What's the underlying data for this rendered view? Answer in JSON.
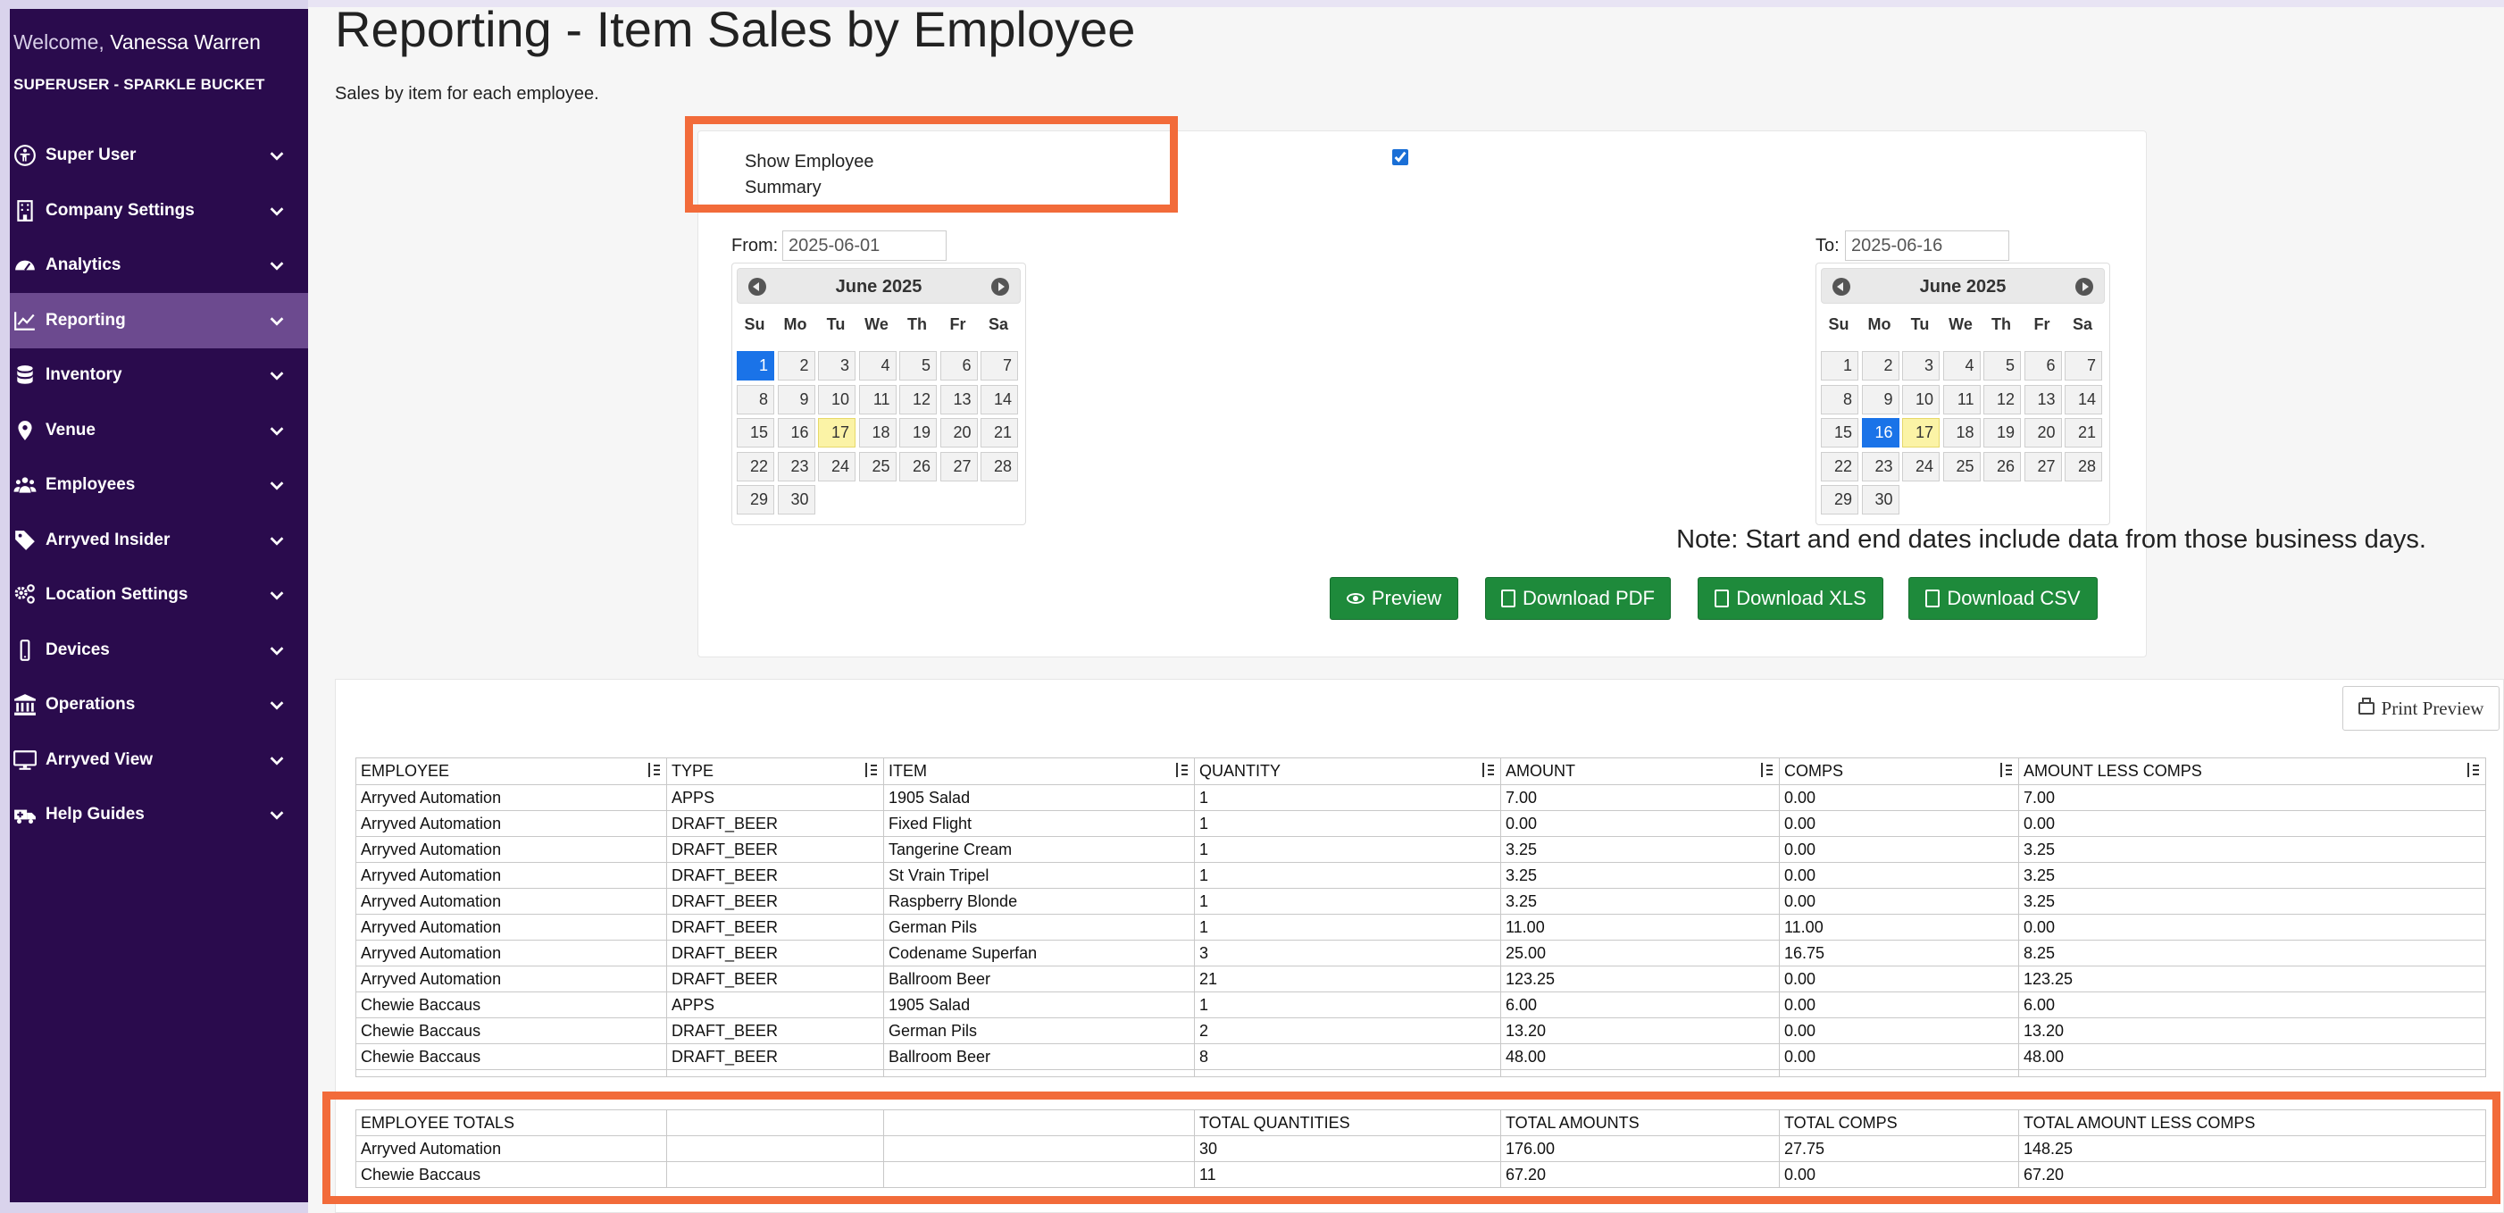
{
  "sidebar": {
    "welcome_label": "Welcome,",
    "user_name": "Vanessa Warren",
    "role": "SUPERUSER - SPARKLE BUCKET",
    "items": [
      {
        "label": "Super User",
        "icon": "accessibility-icon"
      },
      {
        "label": "Company Settings",
        "icon": "building-icon"
      },
      {
        "label": "Analytics",
        "icon": "gauge-icon"
      },
      {
        "label": "Reporting",
        "icon": "line-chart-icon",
        "active": true
      },
      {
        "label": "Inventory",
        "icon": "database-icon"
      },
      {
        "label": "Venue",
        "icon": "map-pin-icon"
      },
      {
        "label": "Employees",
        "icon": "users-icon"
      },
      {
        "label": "Arryved Insider",
        "icon": "tag-icon"
      },
      {
        "label": "Location Settings",
        "icon": "cogs-icon"
      },
      {
        "label": "Devices",
        "icon": "mobile-icon"
      },
      {
        "label": "Operations",
        "icon": "bank-icon"
      },
      {
        "label": "Arryved View",
        "icon": "monitor-icon"
      },
      {
        "label": "Help Guides",
        "icon": "ambulance-icon"
      }
    ]
  },
  "page": {
    "title": "Reporting - Item Sales by Employee",
    "subtitle": "Sales by item for each employee."
  },
  "filters": {
    "summary_label": "Show Employee Summary",
    "summary_checked": true,
    "from_label": "From:",
    "from_value": "2025-06-01",
    "to_label": "To:",
    "to_value": "2025-06-16",
    "note": "Note: Start and end dates include data from those business days."
  },
  "calendars": {
    "month_title": "June 2025",
    "days_of_week": [
      "Su",
      "Mo",
      "Tu",
      "We",
      "Th",
      "Fr",
      "Sa"
    ],
    "days_in_month": 30,
    "first_weekday": 0,
    "today": 17,
    "from_selected": 1,
    "to_selected": 16
  },
  "buttons": {
    "preview": "Preview",
    "download_pdf": "Download PDF",
    "download_xls": "Download XLS",
    "download_csv": "Download CSV",
    "print_preview": "Print Preview"
  },
  "table": {
    "headers": [
      "EMPLOYEE",
      "TYPE",
      "ITEM",
      "QUANTITY",
      "AMOUNT",
      "COMPS",
      "AMOUNT LESS COMPS"
    ],
    "rows": [
      [
        "Arryved Automation",
        "APPS",
        "1905 Salad",
        "1",
        "7.00",
        "0.00",
        "7.00"
      ],
      [
        "Arryved Automation",
        "DRAFT_BEER",
        "Fixed Flight",
        "1",
        "0.00",
        "0.00",
        "0.00"
      ],
      [
        "Arryved Automation",
        "DRAFT_BEER",
        "Tangerine Cream",
        "1",
        "3.25",
        "0.00",
        "3.25"
      ],
      [
        "Arryved Automation",
        "DRAFT_BEER",
        "St Vrain Tripel",
        "1",
        "3.25",
        "0.00",
        "3.25"
      ],
      [
        "Arryved Automation",
        "DRAFT_BEER",
        "Raspberry Blonde",
        "1",
        "3.25",
        "0.00",
        "3.25"
      ],
      [
        "Arryved Automation",
        "DRAFT_BEER",
        "German Pils",
        "1",
        "11.00",
        "11.00",
        "0.00"
      ],
      [
        "Arryved Automation",
        "DRAFT_BEER",
        "Codename Superfan",
        "3",
        "25.00",
        "16.75",
        "8.25"
      ],
      [
        "Arryved Automation",
        "DRAFT_BEER",
        "Ballroom Beer",
        "21",
        "123.25",
        "0.00",
        "123.25"
      ],
      [
        "Chewie Baccaus",
        "APPS",
        "1905 Salad",
        "1",
        "6.00",
        "0.00",
        "6.00"
      ],
      [
        "Chewie Baccaus",
        "DRAFT_BEER",
        "German Pils",
        "2",
        "13.20",
        "0.00",
        "13.20"
      ],
      [
        "Chewie Baccaus",
        "DRAFT_BEER",
        "Ballroom Beer",
        "8",
        "48.00",
        "0.00",
        "48.00"
      ]
    ]
  },
  "totals": {
    "headers": [
      "EMPLOYEE TOTALS",
      "",
      "",
      "TOTAL QUANTITIES",
      "TOTAL AMOUNTS",
      "TOTAL COMPS",
      "TOTAL AMOUNT LESS COMPS"
    ],
    "rows": [
      [
        "Arryved Automation",
        "",
        "",
        "30",
        "176.00",
        "27.75",
        "148.25"
      ],
      [
        "Chewie Baccaus",
        "",
        "",
        "11",
        "67.20",
        "0.00",
        "67.20"
      ]
    ]
  },
  "colors": {
    "sidebar_bg": "#2a0b4d",
    "sidebar_active": "#6c4a8f",
    "button_green": "#1e8a3b",
    "highlight_orange": "#f26b3a",
    "selected_day": "#1a73e8",
    "today_day": "#fbf3a6"
  }
}
